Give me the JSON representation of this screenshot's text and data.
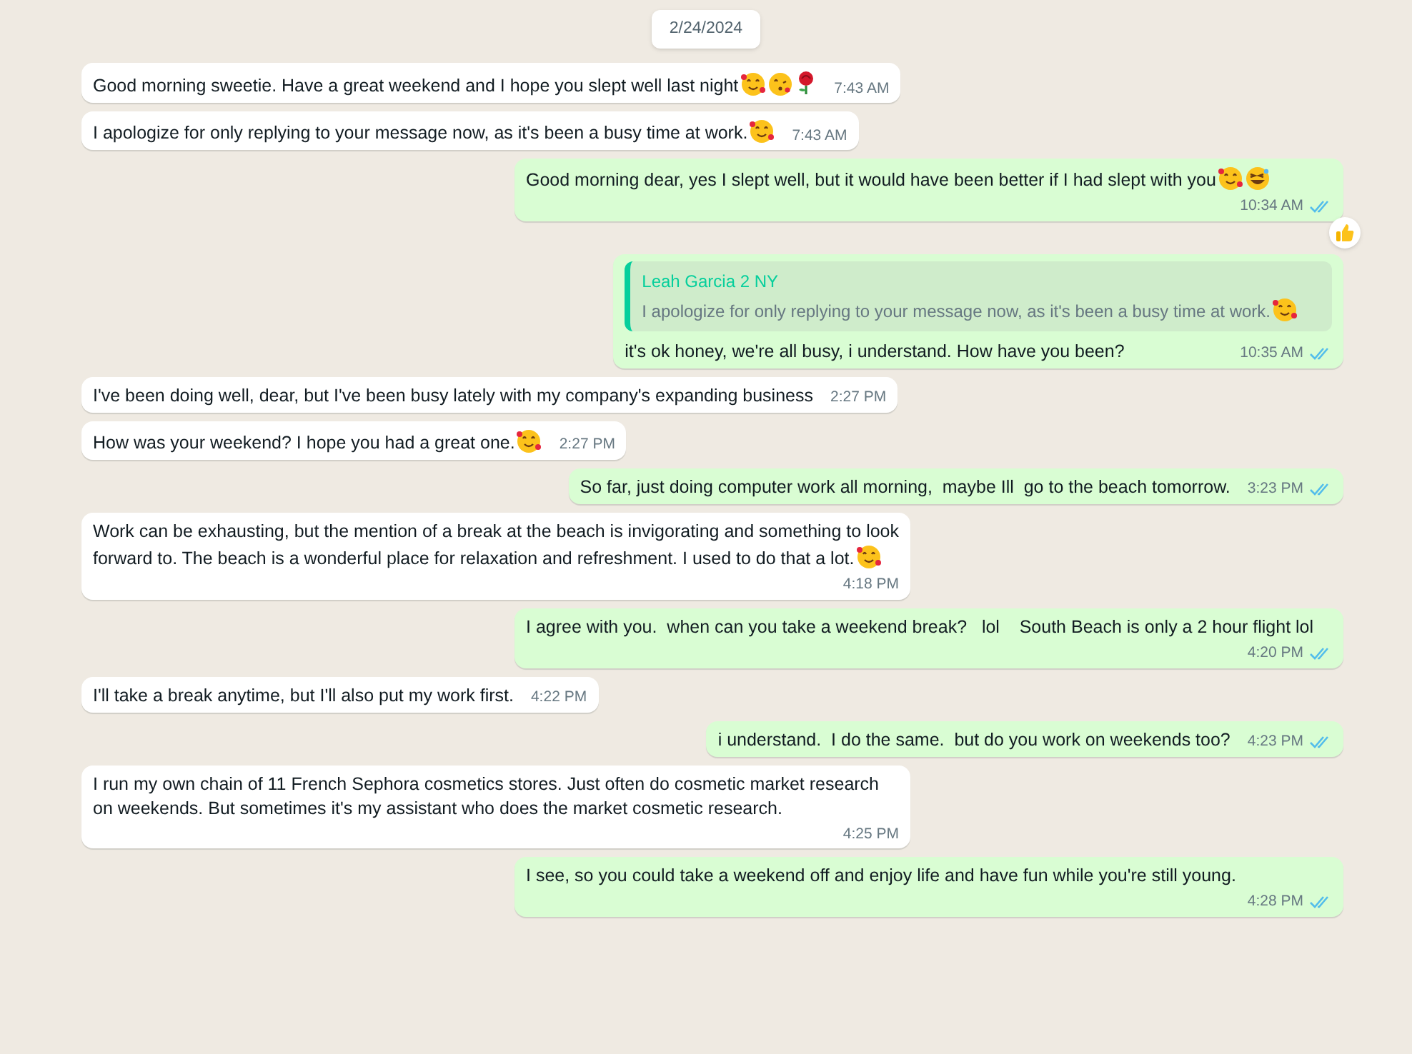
{
  "date_chip": "2/24/2024",
  "messages": [
    {
      "kind": "incoming",
      "text": "Good morning sweetie. Have a great weekend and I hope you slept well last night",
      "emojis": [
        {
          "kind": "hearts"
        },
        {
          "kind": "kiss"
        },
        {
          "kind": "rose"
        }
      ],
      "time": "7:43 AM"
    },
    {
      "kind": "incoming",
      "text": "I apologize for only replying to your message now, as it's been a busy time at work.",
      "emojis": [
        {
          "kind": "hearts"
        }
      ],
      "time": "7:43 AM"
    },
    {
      "kind": "outgoing",
      "text": "Good morning dear, yes I slept well, but it would have been better if I had slept with you",
      "emojis": [
        {
          "kind": "hearts"
        },
        {
          "kind": "laugh"
        }
      ],
      "time": "10:34 AM",
      "read": true,
      "reaction": {
        "kind": "thumbs"
      }
    },
    {
      "kind": "outgoing",
      "quote": {
        "author": "Leah Garcia 2 NY",
        "text": "I apologize for only replying to your message now, as it's been a busy time at work.",
        "emojis": [
          {
            "kind": "hearts"
          }
        ]
      },
      "text": "it's ok honey, we're all busy, i understand. How have you been?",
      "time": "10:35 AM",
      "read": true
    },
    {
      "kind": "incoming",
      "text": "I've been doing well, dear, but I've been busy lately with my company's expanding business",
      "time": "2:27 PM"
    },
    {
      "kind": "incoming",
      "text": "How was your weekend? I hope you had a great one.",
      "emojis": [
        {
          "kind": "hearts"
        }
      ],
      "time": "2:27 PM"
    },
    {
      "kind": "outgoing",
      "text": "So far, just doing computer work all morning,  maybe Ill  go to the beach tomorrow.",
      "time": "3:23 PM",
      "read": true
    },
    {
      "kind": "incoming",
      "text": "Work can be exhausting, but the mention of a break at the beach is invigorating and something to look forward to. The beach is a wonderful place for relaxation and refreshment. I used to do that a lot.",
      "emojis": [
        {
          "kind": "hearts"
        }
      ],
      "time": "4:18 PM"
    },
    {
      "kind": "outgoing",
      "text": "I agree with you.  when can you take a weekend break?   lol    South Beach is only a 2 hour flight lol",
      "time": "4:20 PM",
      "read": true
    },
    {
      "kind": "incoming",
      "text": "I'll take a break anytime, but I'll also put my work first.",
      "time": "4:22 PM"
    },
    {
      "kind": "outgoing",
      "text": "i understand.  I do the same.  but do you work on weekends too?",
      "time": "4:23 PM",
      "read": true
    },
    {
      "kind": "incoming",
      "text": "I run my own chain of 11 French Sephora cosmetics stores. Just often do cosmetic market research on weekends. But sometimes it's my assistant who does the market cosmetic research.",
      "time": "4:25 PM"
    },
    {
      "kind": "outgoing",
      "text": "I see, so you could take a weekend off and enjoy life and have fun while you're still young.",
      "time": "4:28 PM",
      "read": true
    }
  ]
}
